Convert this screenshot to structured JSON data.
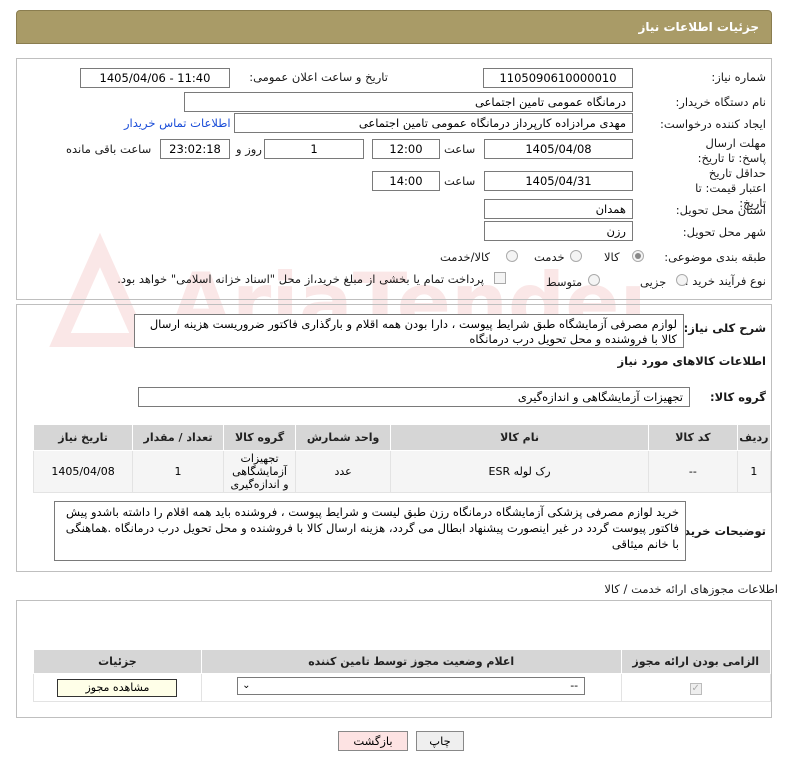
{
  "header": {
    "title": "جزئیات اطلاعات نیاز"
  },
  "form": {
    "need_number": {
      "label": "شماره نیاز:",
      "value": "1105090610000010"
    },
    "announce_datetime": {
      "label": "تاریخ و ساعت اعلان عمومی:",
      "value": "1405/04/06 - 11:40"
    },
    "buyer_org": {
      "label": "نام دستگاه خریدار:",
      "value": "درمانگاه عمومی تامین اجتماعی"
    },
    "requester": {
      "label": "ایجاد کننده درخواست:",
      "value": "مهدی مرادزاده کارپرداز درمانگاه عمومی تامین اجتماعی",
      "contact_link": "اطلاعات تماس خریدار"
    },
    "deadline": {
      "label": "مهلت ارسال پاسخ: تا تاریخ:",
      "date": "1405/04/08",
      "time_label": "ساعت",
      "time": "12:00",
      "days": "1",
      "days_label": "روز و",
      "remaining": "23:02:18",
      "remaining_label": "ساعت باقی مانده"
    },
    "validity": {
      "label": "حداقل تاریخ اعتبار قیمت: تا تاریخ:",
      "date": "1405/04/31",
      "time_label": "ساعت",
      "time": "14:00"
    },
    "province": {
      "label": "استان محل تحویل:",
      "value": "همدان"
    },
    "city": {
      "label": "شهر محل تحویل:",
      "value": "رزن"
    },
    "category": {
      "label": "طبقه بندی موضوعی:",
      "options": [
        "کالا",
        "خدمت",
        "کالا/خدمت"
      ],
      "selected": "کالا"
    },
    "process": {
      "label": "نوع فرآیند خرید :",
      "options": [
        "جزیی",
        "متوسط"
      ],
      "selected": "جزیی",
      "payment_note": "پرداخت تمام یا بخشی از مبلغ خرید،از محل \"اسناد خزانه اسلامی\" خواهد بود."
    }
  },
  "summary": {
    "label": "شرح کلی نیاز:",
    "text": "لوازم مصرفی آزمایشگاه  طبق شرایط پیوست ، دارا بودن همه اقلام و بارگذاری فاکتور ضروریست هزینه ارسال کالا با فروشنده  و محل تحویل درب درمانگاه"
  },
  "goods": {
    "section_title": "اطلاعات کالاهای مورد نیاز",
    "group_label": "گروه کالا:",
    "group_value": "تجهیزات آزمایشگاهی و اندازه‌گیری",
    "columns": [
      "ردیف",
      "کد کالا",
      "نام کالا",
      "واحد شمارش",
      "گروه کالا",
      "تعداد / مقدار",
      "تاریخ نیاز"
    ],
    "rows": [
      {
        "row": "1",
        "code": "--",
        "name": "رک لوله ESR",
        "unit": "عدد",
        "group": "تجهیزات آزمایشگاهی و اندازه‌گیری",
        "qty": "1",
        "date": "1405/04/08"
      }
    ]
  },
  "buyer_notes": {
    "label": "توضیحات خریدار:",
    "text": "خرید لوازم مصرفی پزشکی  آزمایشگاه درمانگاه رزن طبق لیست و شرایط پیوست ، فروشنده باید همه اقلام را داشته باشدو پیش فاکتور پیوست گردد در غیر اینصورت پیشنهاد ابطال می گردد، هزینه ارسال کالا با فروشنده  و محل تحویل درب درمانگاه .هماهنگی با خانم میثاقی"
  },
  "permits": {
    "section_title": "اطلاعات مجوزهای ارائه خدمت / کالا",
    "columns": [
      "الزامی بودن ارائه مجوز",
      "اعلام وضعیت مجوز توسط تامین کننده",
      "جزئیات"
    ],
    "row": {
      "select_value": "--",
      "view_button": "مشاهده مجوز"
    }
  },
  "buttons": {
    "print": "چاپ",
    "back": "بازگشت"
  },
  "watermark": {
    "text": "AriaTender.net"
  },
  "colors": {
    "header_bg": "#a99b67",
    "link": "#1a4dd8",
    "back_button_bg": "#fde3e3"
  }
}
